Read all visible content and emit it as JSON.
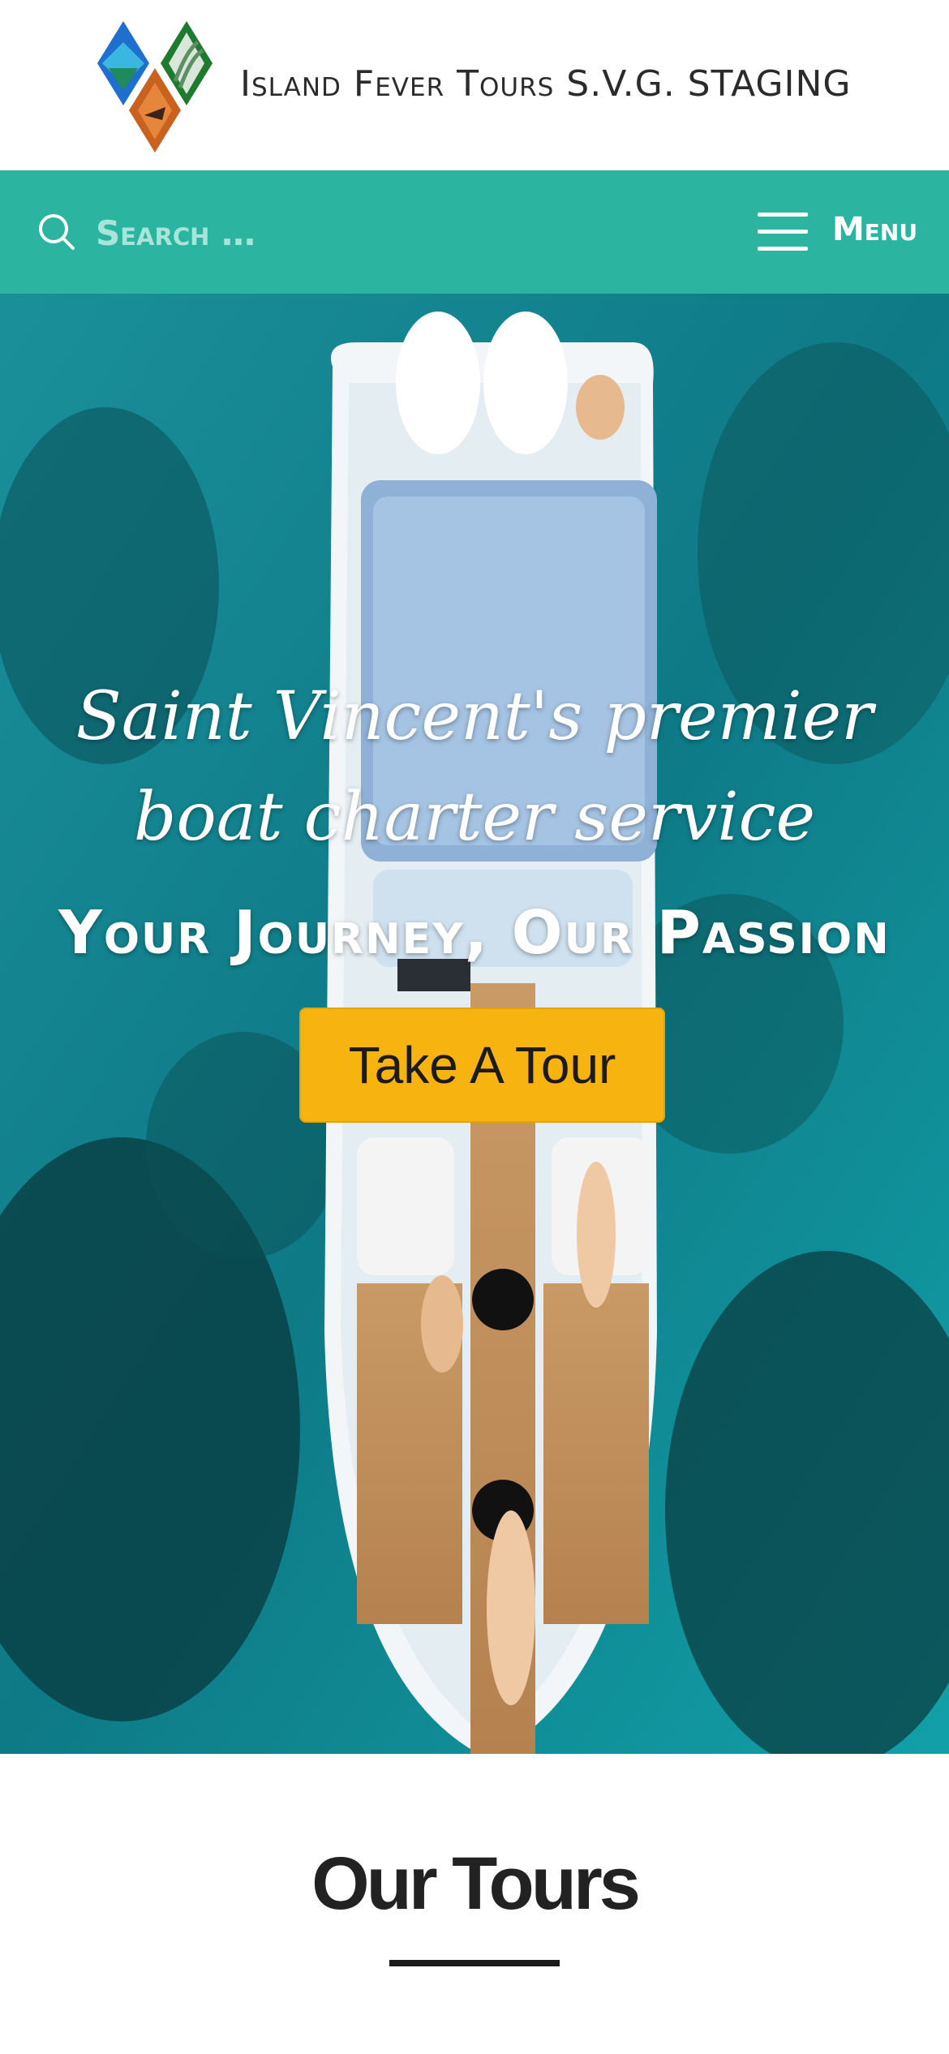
{
  "header": {
    "site_title": "Island Fever Tours S.V.G. STAGING",
    "logo_icon": "diamond-tiles-logo"
  },
  "nav": {
    "search_placeholder": "Search …",
    "search_icon": "search-icon",
    "menu_label": "Menu",
    "menu_icon": "hamburger-icon"
  },
  "hero": {
    "tagline": "Saint Vincent's premier boat charter service",
    "heading": "Your Journey, Our Passion",
    "cta_label": "Take A Tour",
    "image": "aerial-speedboat-on-turquoise-water"
  },
  "tours": {
    "heading": "Our Tours"
  },
  "colors": {
    "nav_bar": "#2bb5a0",
    "cta_button": "#f7b411",
    "site_title_text": "#2b2b2b",
    "tours_heading_text": "#222222"
  }
}
